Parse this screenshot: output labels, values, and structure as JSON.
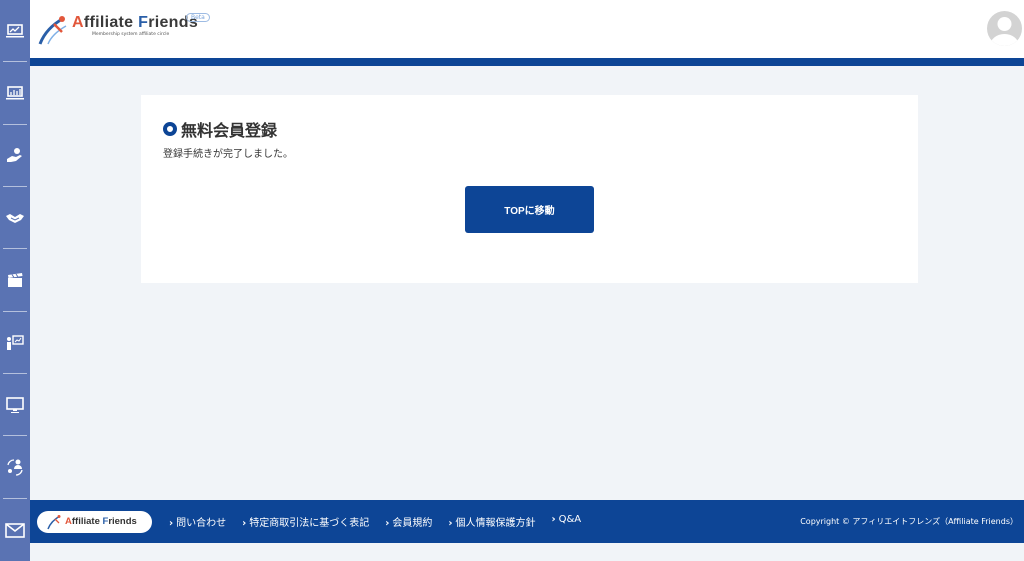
{
  "header": {
    "logo_title_a": "A",
    "logo_title_rest1": "ffiliate ",
    "logo_title_f": "F",
    "logo_title_rest2": "riends",
    "logo_subtitle": "Membership system affiliate circle",
    "beta_label": "Beta"
  },
  "sidebar": {
    "items": [
      {
        "icon": "laptop-chart-icon"
      },
      {
        "icon": "laptop-chart-icon"
      },
      {
        "icon": "hand-coin-icon"
      },
      {
        "icon": "handshake-icon"
      },
      {
        "icon": "clapperboard-icon"
      },
      {
        "icon": "presentation-icon"
      },
      {
        "icon": "monitor-icon"
      },
      {
        "icon": "people-exchange-icon"
      },
      {
        "icon": "mail-icon"
      }
    ]
  },
  "main": {
    "title": "無料会員登録",
    "message": "登録手続きが完了しました。",
    "top_button_label": "TOPに移動"
  },
  "footer": {
    "logo_text_a": "A",
    "logo_text_rest1": "ffiliate ",
    "logo_text_f": "F",
    "logo_text_rest2": "riends",
    "links": [
      {
        "label": "問い合わせ"
      },
      {
        "label": "特定商取引法に基づく表記"
      },
      {
        "label": "会員規約"
      },
      {
        "label": "個人情報保護方針"
      },
      {
        "label": "Q&A"
      }
    ],
    "chevron": "›",
    "copyright": "Copyright © アフィリエイトフレンズ（Affiliate Friends）"
  },
  "colors": {
    "primary": "#0d4596",
    "sidebar": "#5a73b3",
    "background": "#f1f4f8",
    "logo_accent": "#e2573b"
  }
}
